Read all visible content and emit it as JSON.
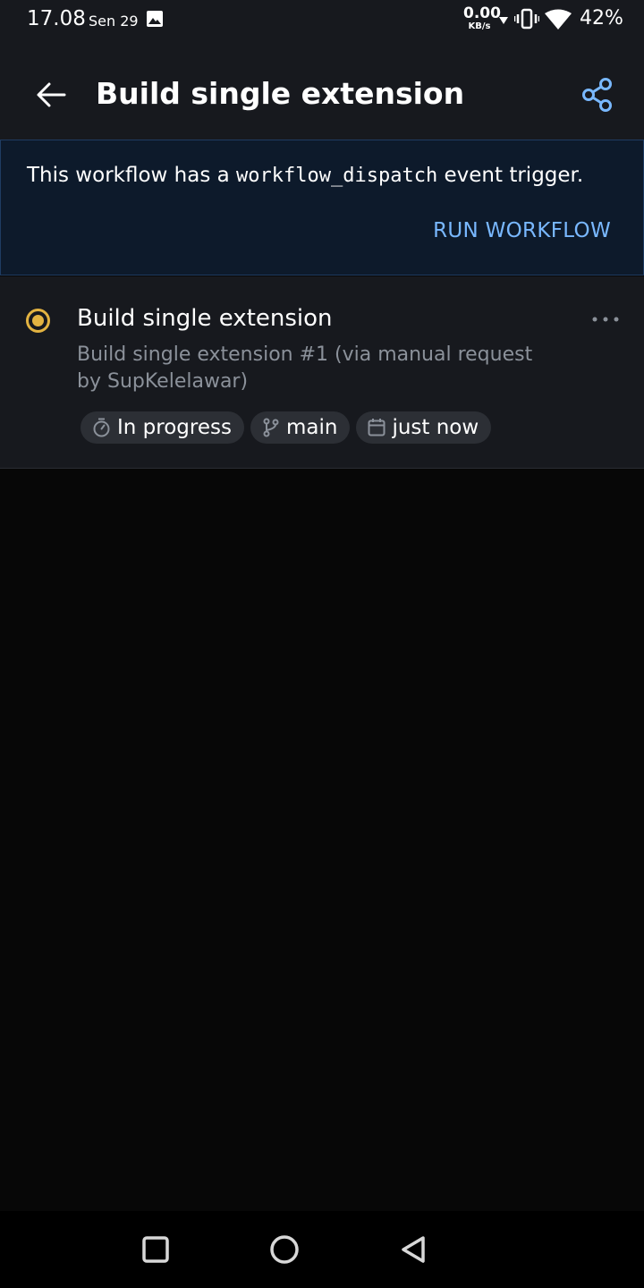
{
  "status_bar": {
    "time": "17.08",
    "date": "Sen 29",
    "net_speed_value": "0.00",
    "net_speed_unit": "KB/s",
    "battery": "42%"
  },
  "header": {
    "title": "Build single extension"
  },
  "banner": {
    "text_before": "This workflow has a ",
    "code": "workflow_dispatch",
    "text_after": " event trigger.",
    "run_button": "RUN WORKFLOW"
  },
  "run": {
    "title": "Build single extension",
    "subtitle": "Build single extension #1 (via manual request by SupKelelawar)",
    "status_color": "#e3b341",
    "chips": [
      {
        "icon": "timer-icon",
        "label": "In progress"
      },
      {
        "icon": "branch-icon",
        "label": "main"
      },
      {
        "icon": "calendar-icon",
        "label": "just now"
      }
    ]
  },
  "colors": {
    "accent": "#79b8ff",
    "banner_bg": "#0d1a2b",
    "in_progress": "#e3b341"
  }
}
